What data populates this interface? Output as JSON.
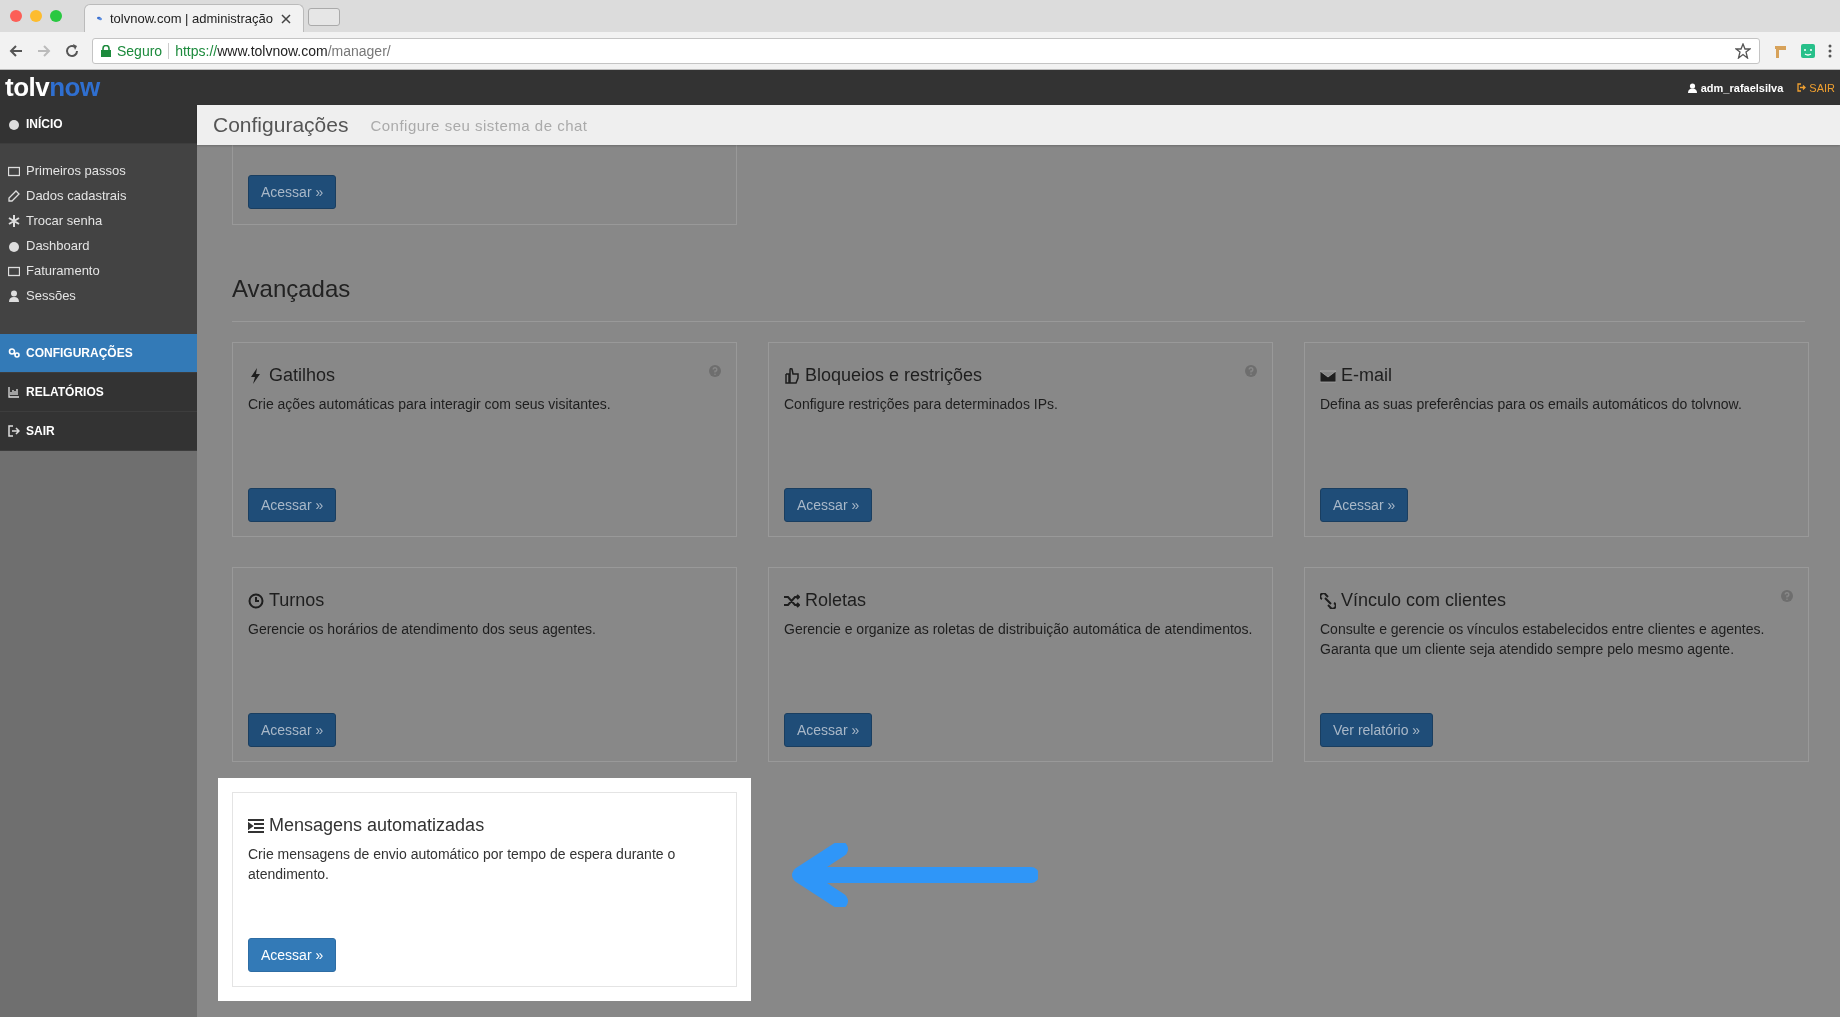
{
  "browser": {
    "tab_title": "tolvnow.com | administração",
    "security": "Seguro",
    "url_scheme": "https://",
    "url_host": "www.tolvnow.com",
    "url_path": "/manager/"
  },
  "app_header": {
    "logo_left": "tolv",
    "logo_right": "now",
    "user": "adm_rafaelsilva",
    "logout": "SAIR"
  },
  "sidebar": {
    "items": [
      {
        "kind": "section",
        "label": "INÍCIO",
        "selected": false
      },
      {
        "kind": "link",
        "label": "Primeiros passos",
        "selected": false
      },
      {
        "kind": "link",
        "label": "Dados cadastrais",
        "selected": false
      },
      {
        "kind": "link",
        "label": "Trocar senha",
        "selected": false
      },
      {
        "kind": "link",
        "label": "Dashboard",
        "selected": false
      },
      {
        "kind": "link",
        "label": "Faturamento",
        "selected": false
      },
      {
        "kind": "link",
        "label": "Sessões",
        "selected": false
      },
      {
        "kind": "section",
        "label": "CONFIGURAÇÕES",
        "selected": true
      },
      {
        "kind": "section",
        "label": "RELATÓRIOS",
        "selected": false
      },
      {
        "kind": "section",
        "label": "SAIR",
        "selected": false
      }
    ]
  },
  "page_header": {
    "title": "Configurações",
    "subtitle": "Configure seu sistema de chat"
  },
  "top_card": {
    "button": "Acessar »"
  },
  "section": {
    "title": "Avançadas"
  },
  "cards": [
    {
      "title": "Gatilhos",
      "description": "Crie ações automáticas para interagir com seus visitantes.",
      "button": "Acessar »",
      "help": true,
      "highlighted": false
    },
    {
      "title": "Bloqueios e restrições",
      "description": "Configure restrições para determinados IPs.",
      "button": "Acessar »",
      "help": true,
      "highlighted": false
    },
    {
      "title": "E-mail",
      "description": "Defina as suas preferências para os emails automáticos do tolvnow.",
      "button": "Acessar »",
      "help": false,
      "highlighted": false
    },
    {
      "title": "Turnos",
      "description": "Gerencie os horários de atendimento dos seus agentes.",
      "button": "Acessar »",
      "help": false,
      "highlighted": false
    },
    {
      "title": "Roletas",
      "description": "Gerencie e organize as roletas de distribuição automática de atendimentos.",
      "button": "Acessar »",
      "help": false,
      "highlighted": false
    },
    {
      "title": "Vínculo com clientes",
      "description": "Consulte e gerencie os vínculos estabelecidos entre clientes e agentes. Garanta que um cliente seja atendido sempre pelo mesmo agente.",
      "button": "Ver relatório »",
      "help": true,
      "highlighted": false
    },
    {
      "title": "Mensagens automatizadas",
      "description": "Crie mensagens de envio automático por tempo de espera durante o atendimento.",
      "button": "Acessar »",
      "help": false,
      "highlighted": true
    }
  ]
}
